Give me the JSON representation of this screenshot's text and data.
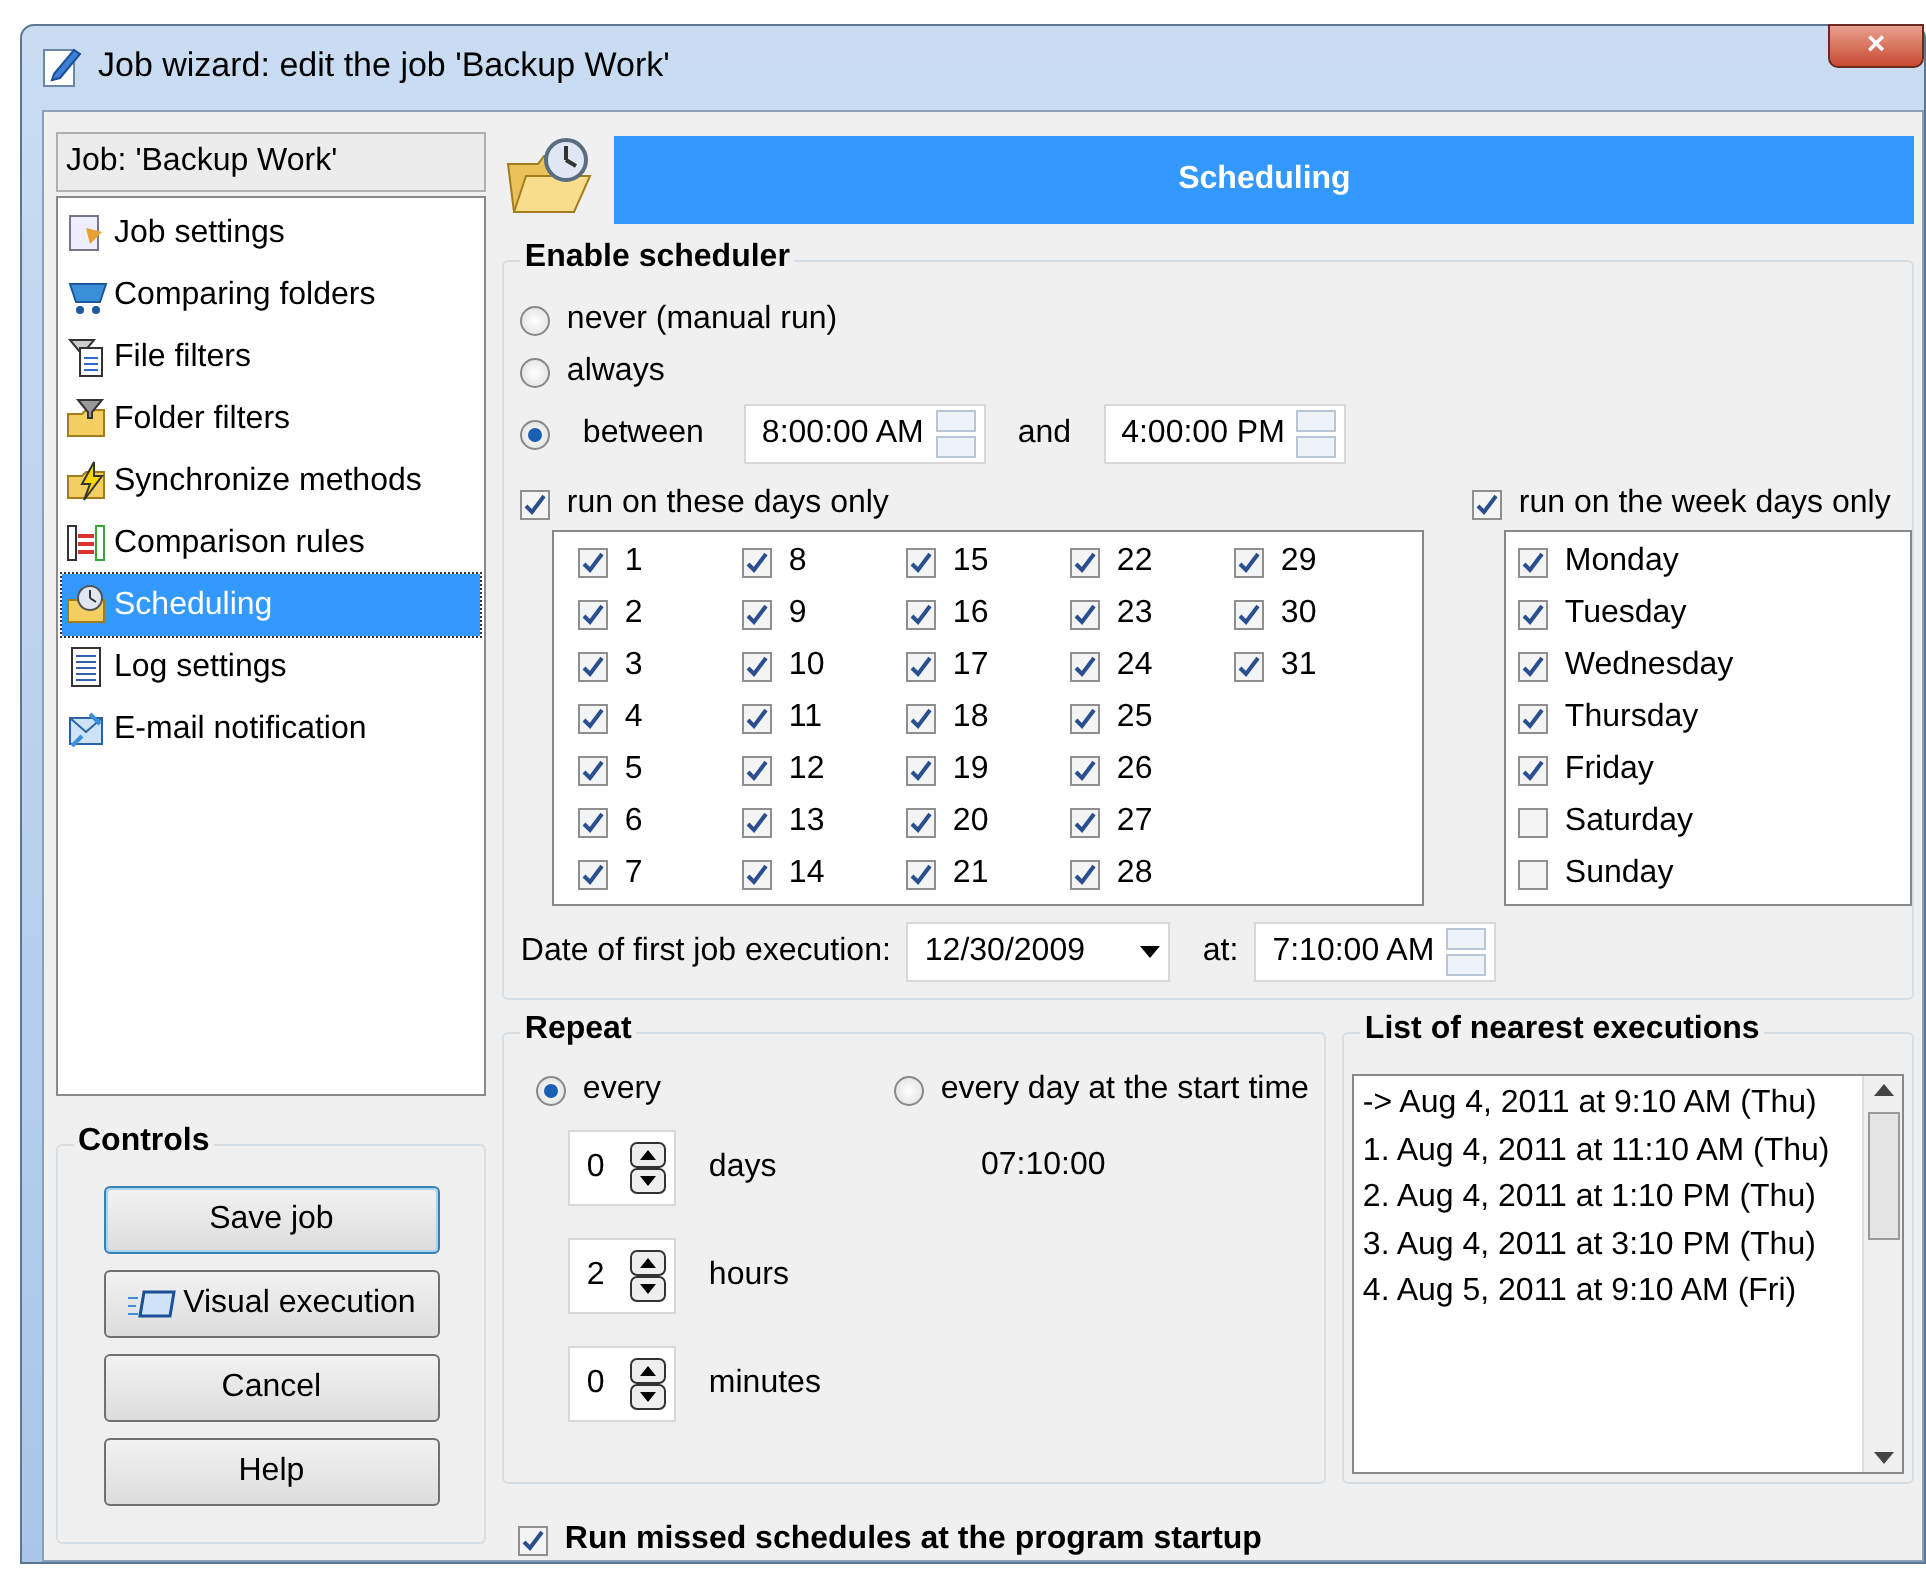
{
  "window": {
    "title": "Job wizard: edit the job 'Backup Work'",
    "close": "×"
  },
  "sidebar": {
    "job_label": "Job: 'Backup Work'",
    "items": [
      {
        "label": "Job settings",
        "selected": false
      },
      {
        "label": "Comparing folders",
        "selected": false
      },
      {
        "label": "File filters",
        "selected": false
      },
      {
        "label": "Folder filters",
        "selected": false
      },
      {
        "label": "Synchronize methods",
        "selected": false
      },
      {
        "label": "Comparison rules",
        "selected": false
      },
      {
        "label": "Scheduling",
        "selected": true
      },
      {
        "label": "Log settings",
        "selected": false
      },
      {
        "label": "E-mail notification",
        "selected": false
      }
    ]
  },
  "controls": {
    "title": "Controls",
    "buttons": [
      {
        "label": "Save job",
        "kind": "default"
      },
      {
        "label": "Visual execution",
        "kind": "icon"
      },
      {
        "label": "Cancel",
        "kind": "plain"
      },
      {
        "label": "Help",
        "kind": "plain"
      }
    ]
  },
  "header": {
    "title": "Scheduling"
  },
  "scheduler": {
    "title": "Enable scheduler",
    "options": [
      {
        "label": "never (manual run)",
        "selected": false
      },
      {
        "label": "always",
        "selected": false
      },
      {
        "label": "between",
        "selected": true
      }
    ],
    "start_time": "8:00:00 AM",
    "and_label": "and",
    "end_time": "4:00:00 PM",
    "days_only": {
      "label": "run on these days only",
      "checked": true
    },
    "days": [
      {
        "label": "1",
        "checked": true
      },
      {
        "label": "2",
        "checked": true
      },
      {
        "label": "3",
        "checked": true
      },
      {
        "label": "4",
        "checked": true
      },
      {
        "label": "5",
        "checked": true
      },
      {
        "label": "6",
        "checked": true
      },
      {
        "label": "7",
        "checked": true
      },
      {
        "label": "8",
        "checked": true
      },
      {
        "label": "9",
        "checked": true
      },
      {
        "label": "10",
        "checked": true
      },
      {
        "label": "11",
        "checked": true
      },
      {
        "label": "12",
        "checked": true
      },
      {
        "label": "13",
        "checked": true
      },
      {
        "label": "14",
        "checked": true
      },
      {
        "label": "15",
        "checked": true
      },
      {
        "label": "16",
        "checked": true
      },
      {
        "label": "17",
        "checked": true
      },
      {
        "label": "18",
        "checked": true
      },
      {
        "label": "19",
        "checked": true
      },
      {
        "label": "20",
        "checked": true
      },
      {
        "label": "21",
        "checked": true
      },
      {
        "label": "22",
        "checked": true
      },
      {
        "label": "23",
        "checked": true
      },
      {
        "label": "24",
        "checked": true
      },
      {
        "label": "25",
        "checked": true
      },
      {
        "label": "26",
        "checked": true
      },
      {
        "label": "27",
        "checked": true
      },
      {
        "label": "28",
        "checked": true
      },
      {
        "label": "29",
        "checked": true
      },
      {
        "label": "30",
        "checked": true
      },
      {
        "label": "31",
        "checked": true
      }
    ],
    "weekdays_only": {
      "label": "run on the week days only",
      "checked": true
    },
    "weekdays": [
      {
        "label": "Monday",
        "checked": true
      },
      {
        "label": "Tuesday",
        "checked": true
      },
      {
        "label": "Wednesday",
        "checked": true
      },
      {
        "label": "Thursday",
        "checked": true
      },
      {
        "label": "Friday",
        "checked": true
      },
      {
        "label": "Saturday",
        "checked": false
      },
      {
        "label": "Sunday",
        "checked": false
      }
    ],
    "first_date_label": "Date of first job execution:",
    "first_date": "12/30/2009",
    "at_label": "at:",
    "first_time": "7:10:00 AM"
  },
  "repeat": {
    "title": "Repeat",
    "options": [
      {
        "label": "every",
        "selected": true
      },
      {
        "label": "every day at the start time",
        "selected": false
      }
    ],
    "start_time": "07:10:00",
    "intervals": [
      {
        "value": "0",
        "unit": "days"
      },
      {
        "value": "2",
        "unit": "hours"
      },
      {
        "value": "0",
        "unit": "minutes"
      }
    ]
  },
  "executions": {
    "title": "List of nearest executions",
    "items": [
      "-> Aug 4, 2011 at 9:10 AM (Thu)",
      "1. Aug 4, 2011 at 11:10 AM (Thu)",
      "2. Aug 4, 2011 at 1:10 PM (Thu)",
      "3. Aug 4, 2011 at 3:10 PM (Thu)",
      "4. Aug 5, 2011 at 9:10 AM (Fri)"
    ]
  },
  "run_missed": {
    "label": "Run missed schedules at the program startup",
    "checked": true
  }
}
